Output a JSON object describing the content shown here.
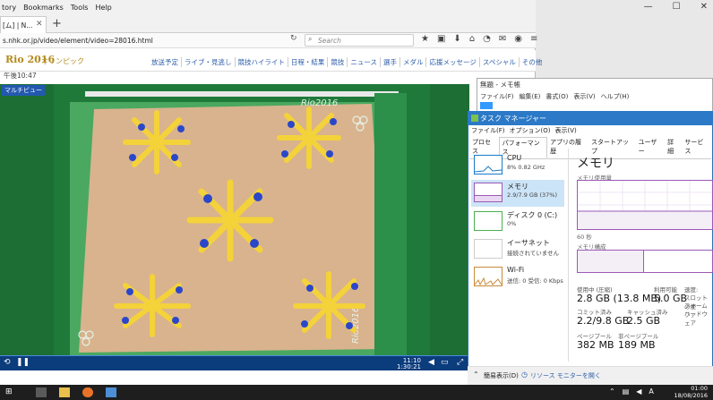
{
  "browser": {
    "menu": [
      "tory",
      "Bookmarks",
      "Tools",
      "Help"
    ],
    "tab_title": "[ム] | N...",
    "url": "s.nhk.or.jp/video/element/video=28016.html",
    "search_placeholder": "Search",
    "window_controls": [
      "—",
      "☐",
      "✕"
    ]
  },
  "site": {
    "logo": "Rio 2016",
    "logo_sub": "オリンピック",
    "nav": [
      "放送予定",
      "ライブ・見逃し",
      "競技ハイライト",
      "日程・結果",
      "競技",
      "ニュース",
      "選手",
      "メダル",
      "応援メッセージ",
      "スペシャル",
      "その他"
    ],
    "time": "午後10:47"
  },
  "player": {
    "label": "マルチビュー",
    "elapsed": "11:10",
    "total": "1:30:21",
    "watermark": "Rio2016"
  },
  "notepad": {
    "title": "無題 - メモ帳",
    "menu": [
      "ファイル(F)",
      "編集(E)",
      "書式(O)",
      "表示(V)",
      "ヘルプ(H)"
    ]
  },
  "taskmgr": {
    "title": "タスク マネージャー",
    "menu": [
      "ファイル(F)",
      "オプション(O)",
      "表示(V)"
    ],
    "tabs": [
      "プロセス",
      "パフォーマンス",
      "アプリの履歴",
      "スタートアップ",
      "ユーザー",
      "詳細",
      "サービス"
    ],
    "active_tab": "パフォーマンス",
    "side": [
      {
        "name": "CPU",
        "sub": "8% 0.82 GHz",
        "color": "#1a7ac9"
      },
      {
        "name": "メモリ",
        "sub": "2.9/7.9 GB (37%)",
        "color": "#9b59b6"
      },
      {
        "name": "ディスク 0 (C:)",
        "sub": "0%",
        "color": "#4caf50"
      },
      {
        "name": "イーサネット",
        "sub": "接続されていません",
        "color": "#c98a3a"
      },
      {
        "name": "Wi-Fi",
        "sub": "送信: 0 受信: 0 Kbps",
        "color": "#c98a3a"
      }
    ],
    "mem_title": "メモリ",
    "mem_usage_label": "メモリ使用量",
    "mem_graph_bottom": "60 秒",
    "mem_comp_label": "メモリ構成",
    "stats": {
      "in_use_label": "使用中 (圧縮)",
      "in_use": "2.8 GB (13.8 MB)",
      "available_label": "利用可能",
      "available": "5.0 GB",
      "speed_label": "速度:",
      "committed_label": "コミット済み",
      "committed": "2.2/9.8 GB",
      "cached_label": "キャッシュ済み",
      "cached": "2.5 GB",
      "paged_label": "ページプール",
      "paged": "382 MB",
      "nonpaged_label": "非ページプール",
      "nonpaged": "189 MB",
      "right_labels": [
        "スロットの使",
        "フォーム ファ",
        "ハードウェア"
      ]
    },
    "footer_less": "簡易表示(D)",
    "footer_resmon": "リソース モニターを開く"
  },
  "taskbar": {
    "time": "01:00",
    "date": "18/08/2016",
    "ime": "A"
  }
}
